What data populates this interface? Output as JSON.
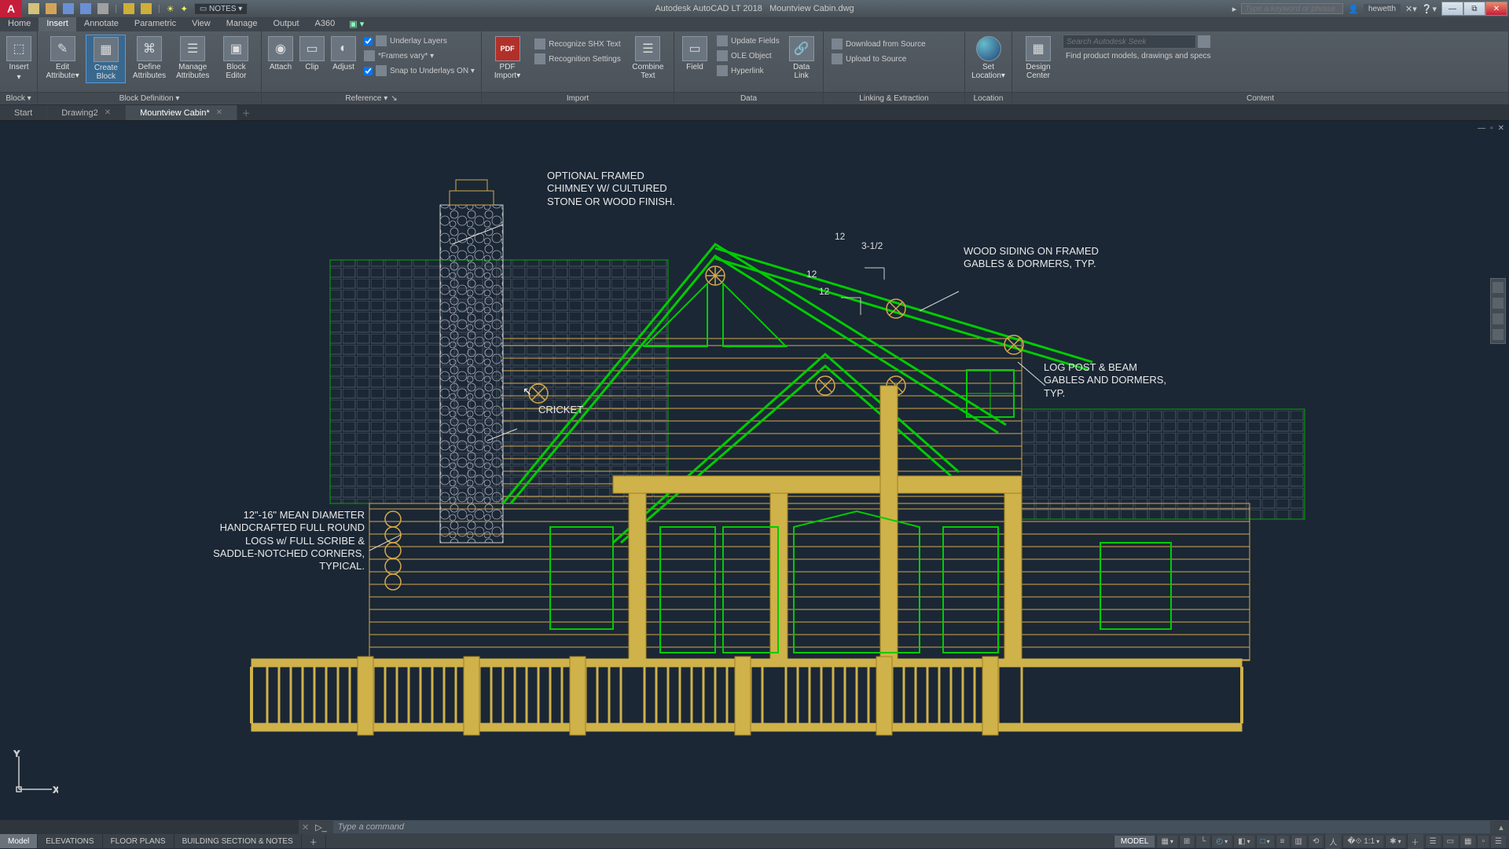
{
  "title": {
    "app": "Autodesk AutoCAD LT 2018",
    "file": "Mountview Cabin.dwg"
  },
  "qat": {
    "notes_label": "NOTES"
  },
  "search": {
    "placeholder": "Type a keyword or phrase"
  },
  "user": {
    "name": "hewetth"
  },
  "menu": {
    "tabs": [
      "Home",
      "Insert",
      "Annotate",
      "Parametric",
      "View",
      "Manage",
      "Output",
      "A360"
    ],
    "active": 1,
    "extra": "▣ ▾"
  },
  "ribbon": {
    "panels": [
      {
        "title": "Block ▾",
        "big": [
          {
            "label": "Insert",
            "ico": "⬚"
          }
        ],
        "title2": "Block Definition ▾",
        "big2": [
          {
            "label": "Edit\nAttribute",
            "ico": "✎"
          },
          {
            "label": "Create\nBlock",
            "ico": "▦",
            "active": true
          },
          {
            "label": "Define\nAttributes",
            "ico": "⌘"
          },
          {
            "label": "Manage\nAttributes",
            "ico": "☰"
          },
          {
            "label": "Block\nEditor",
            "ico": "▣"
          }
        ]
      }
    ],
    "insert_small": [
      {
        "label": "Attach"
      },
      {
        "label": "Clip"
      },
      {
        "label": "Adjust"
      }
    ],
    "ref_rows": [
      {
        "check": true,
        "label": "Underlay Layers"
      },
      {
        "combo": "*Frames vary* ▾"
      },
      {
        "check": true,
        "label": "Snap to Underlays ON ▾"
      }
    ],
    "ref_title": "Reference ▾",
    "pdf": {
      "label": "PDF\nImport"
    },
    "import_rows": [
      {
        "label": "Recognize SHX Text"
      },
      {
        "label": "Recognition Settings"
      }
    ],
    "import_big": [
      {
        "label": "Combine\nText",
        "ico": "☰"
      }
    ],
    "import_title": "Import",
    "data_big": [
      {
        "label": "Field",
        "ico": "▭"
      }
    ],
    "data_rows": [
      {
        "label": "Update Fields"
      },
      {
        "label": "OLE Object"
      },
      {
        "label": "Hyperlink"
      }
    ],
    "data_big2": [
      {
        "label": "Data\nLink",
        "ico": "🔗"
      }
    ],
    "data_title": "Data",
    "link_rows": [
      {
        "label": "Download from Source"
      },
      {
        "label": "Upload to Source"
      }
    ],
    "link_title": "Linking & Extraction",
    "loc_big": [
      {
        "label": "Set\nLocation",
        "ico": "globe"
      }
    ],
    "loc_title": "Location",
    "content_big": [
      {
        "label": "Design\nCenter",
        "ico": "▦"
      }
    ],
    "seek_placeholder": "Search Autodesk Seek",
    "seek_text": "Find product models, drawings and specs",
    "content_title": "Content"
  },
  "file_tabs": [
    {
      "label": "Start",
      "closable": false
    },
    {
      "label": "Drawing2",
      "closable": true
    },
    {
      "label": "Mountview Cabin*",
      "closable": true,
      "active": true
    }
  ],
  "annotations": {
    "chimney": "OPTIONAL FRAMED\nCHIMNEY W/ CULTURED\nSTONE OR WOOD FINISH.",
    "siding": "WOOD SIDING ON FRAMED\nGABLES & DORMERS, TYP.",
    "post": "LOG POST & BEAM\nGABLES AND DORMERS,\nTYP.",
    "cricket": "CRICKET",
    "logs": "12\"-16\" MEAN DIAMETER\nHANDCRAFTED FULL ROUND\nLOGS w/ FULL SCRIBE &\nSADDLE-NOTCHED CORNERS,\nTYPICAL.",
    "dim12a": "12",
    "dim12b": "12",
    "dim12c": "12",
    "slope": "3-1/2"
  },
  "cmd": {
    "placeholder": "Type a command"
  },
  "layouts": [
    "Model",
    "ELEVATIONS",
    "FLOOR PLANS",
    "BUILDING SECTION & NOTES"
  ],
  "status": {
    "model": "MODEL",
    "scale": "1:1"
  }
}
